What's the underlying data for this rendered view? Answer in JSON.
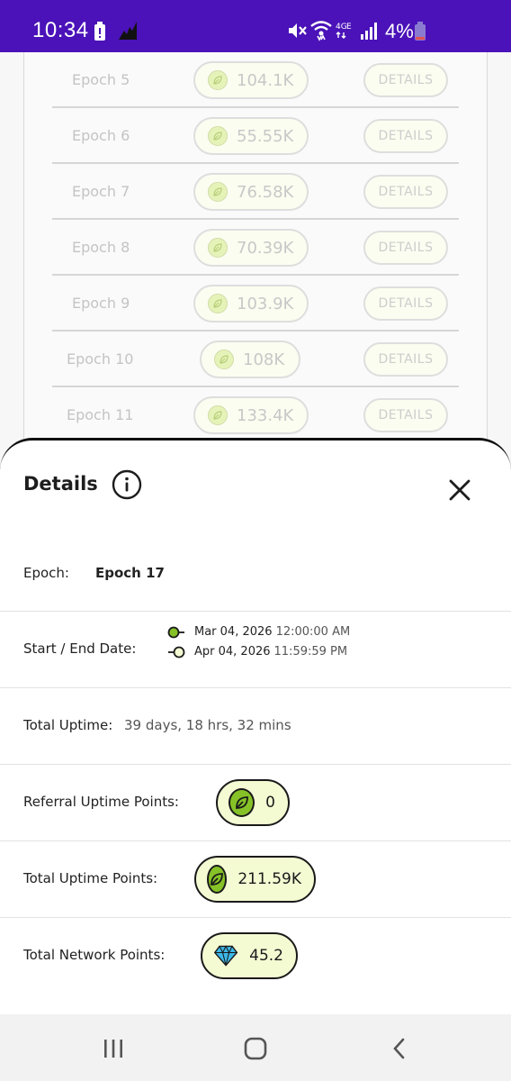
{
  "status_bar": {
    "time": "10:34",
    "battery_percent": "4%",
    "icons": [
      "battery-alert-icon",
      "app-notification-icon",
      "mute-icon",
      "wifi-icon",
      "lte-icon",
      "signal-icon",
      "battery-icon"
    ]
  },
  "epoch_list": {
    "rows": [
      {
        "label": "Epoch 5",
        "points": "104.1K",
        "action": "DETAILS"
      },
      {
        "label": "Epoch 6",
        "points": "55.55K",
        "action": "DETAILS"
      },
      {
        "label": "Epoch 7",
        "points": "76.58K",
        "action": "DETAILS"
      },
      {
        "label": "Epoch 8",
        "points": "70.39K",
        "action": "DETAILS"
      },
      {
        "label": "Epoch 9",
        "points": "103.9K",
        "action": "DETAILS"
      },
      {
        "label": "Epoch 10",
        "points": "108K",
        "action": "DETAILS"
      },
      {
        "label": "Epoch 11",
        "points": "133.4K",
        "action": "DETAILS"
      }
    ]
  },
  "details": {
    "title": "Details",
    "epoch_label": "Epoch:",
    "epoch_value": "Epoch 17",
    "date_label": "Start / End Date:",
    "start_date": "Mar 04, 2026",
    "start_time": "12:00:00 AM",
    "end_date": "Apr 04, 2026",
    "end_time": "11:59:59 PM",
    "uptime_label": "Total Uptime:",
    "uptime_value": "39 days, 18 hrs, 32 mins",
    "referral_label": "Referral Uptime Points:",
    "referral_value": "0",
    "total_uptime_points_label": "Total Uptime Points:",
    "total_uptime_points_value": "211.59K",
    "network_points_label": "Total Network Points:",
    "network_points_value": "45.2"
  },
  "colors": {
    "status_bar": "#4a12b8",
    "accent_green": "#86c227",
    "pill_bg": "#f4fbd3",
    "diamond": "#3db8e8"
  }
}
